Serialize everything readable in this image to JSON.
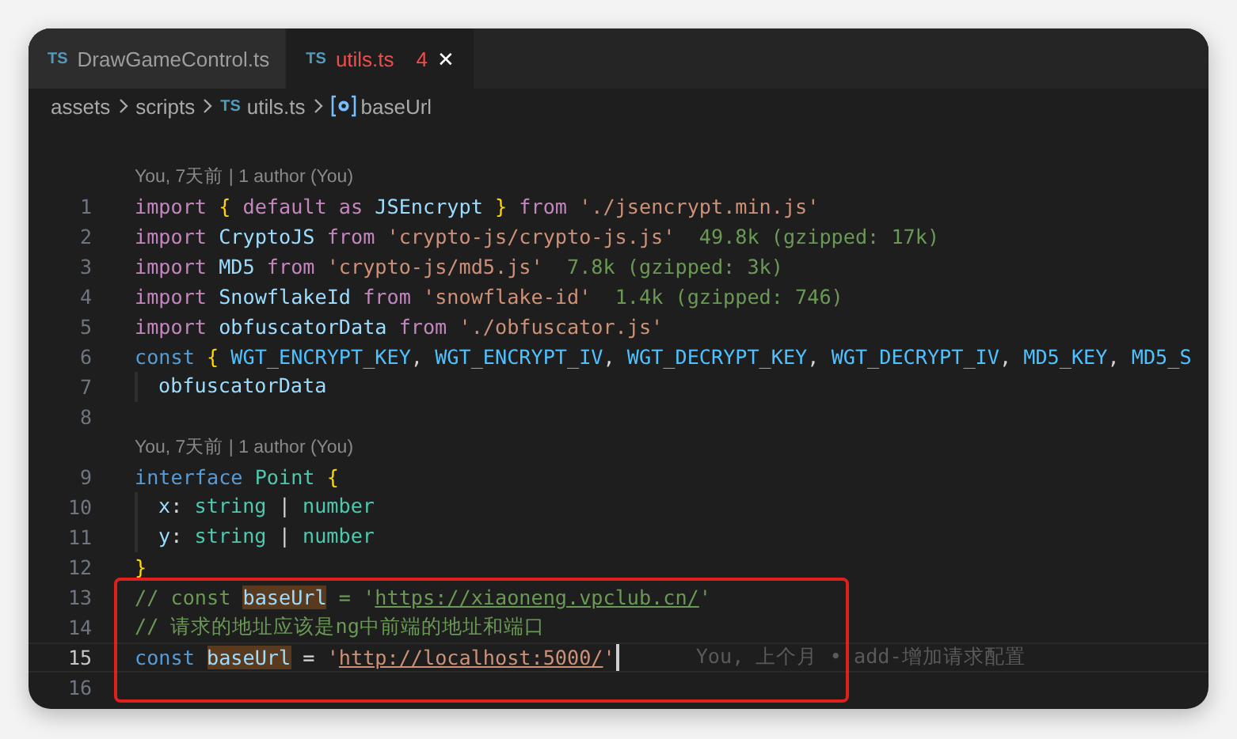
{
  "tabs": [
    {
      "icon_text": "TS",
      "label": "DrawGameControl.ts",
      "selected": false,
      "error": false
    },
    {
      "icon_text": "TS",
      "label": "utils.ts",
      "selected": true,
      "error": true,
      "problems": "4",
      "close": "✕"
    }
  ],
  "breadcrumb": [
    {
      "kind": "folder",
      "text": "assets"
    },
    {
      "kind": "folder",
      "text": "scripts"
    },
    {
      "kind": "file",
      "icon_text": "TS",
      "text": "utils.ts"
    },
    {
      "kind": "symbol",
      "text": "baseUrl"
    }
  ],
  "editor": {
    "lines": [
      {
        "number": "1",
        "codelens": "You, 7天前 | 1 author (You)",
        "current": false,
        "boxed": false,
        "tokens": [
          {
            "kind": "keyword",
            "text": "import "
          },
          {
            "kind": "brace",
            "text": "{ "
          },
          {
            "kind": "keyword",
            "text": "default as "
          },
          {
            "kind": "variable",
            "text": "JSEncrypt "
          },
          {
            "kind": "brace",
            "text": "}"
          },
          {
            "kind": "keyword",
            "text": " from "
          },
          {
            "kind": "string",
            "text": "'./jsencrypt.min.js'"
          }
        ]
      },
      {
        "number": "2",
        "current": false,
        "boxed": false,
        "tokens": [
          {
            "kind": "keyword",
            "text": "import "
          },
          {
            "kind": "variable",
            "text": "CryptoJS "
          },
          {
            "kind": "keyword",
            "text": "from "
          },
          {
            "kind": "string",
            "text": "'crypto-js/crypto-js.js'"
          },
          {
            "kind": "size",
            "text": "  49.8k (gzipped: 17k)"
          }
        ]
      },
      {
        "number": "3",
        "current": false,
        "boxed": false,
        "tokens": [
          {
            "kind": "keyword",
            "text": "import "
          },
          {
            "kind": "variable",
            "text": "MD5 "
          },
          {
            "kind": "keyword",
            "text": "from "
          },
          {
            "kind": "string",
            "text": "'crypto-js/md5.js'"
          },
          {
            "kind": "size",
            "text": "  7.8k (gzipped: 3k)"
          }
        ]
      },
      {
        "number": "4",
        "current": false,
        "boxed": false,
        "tokens": [
          {
            "kind": "keyword",
            "text": "import "
          },
          {
            "kind": "variable",
            "text": "SnowflakeId "
          },
          {
            "kind": "keyword",
            "text": "from "
          },
          {
            "kind": "string",
            "text": "'snowflake-id'"
          },
          {
            "kind": "size",
            "text": "  1.4k (gzipped: 746)"
          }
        ]
      },
      {
        "number": "5",
        "current": false,
        "boxed": false,
        "tokens": [
          {
            "kind": "keyword",
            "text": "import "
          },
          {
            "kind": "variable",
            "text": "obfuscatorData "
          },
          {
            "kind": "keyword",
            "text": "from "
          },
          {
            "kind": "string",
            "text": "'./obfuscator.js'"
          }
        ]
      },
      {
        "number": "6",
        "current": false,
        "boxed": false,
        "tokens": [
          {
            "kind": "storage",
            "text": "const "
          },
          {
            "kind": "brace",
            "text": "{ "
          },
          {
            "kind": "constant",
            "text": "WGT_ENCRYPT_KEY"
          },
          {
            "kind": "plain",
            "text": ", "
          },
          {
            "kind": "constant",
            "text": "WGT_ENCRYPT_IV"
          },
          {
            "kind": "plain",
            "text": ", "
          },
          {
            "kind": "constant",
            "text": "WGT_DECRYPT_KEY"
          },
          {
            "kind": "plain",
            "text": ", "
          },
          {
            "kind": "constant",
            "text": "WGT_DECRYPT_IV"
          },
          {
            "kind": "plain",
            "text": ", "
          },
          {
            "kind": "constant",
            "text": "MD5_KEY"
          },
          {
            "kind": "plain",
            "text": ", "
          },
          {
            "kind": "constant",
            "text": "MD5_S"
          }
        ]
      },
      {
        "number": "7",
        "current": false,
        "boxed": false,
        "indent": true,
        "tokens": [
          {
            "kind": "variable",
            "text": "obfuscatorData"
          }
        ]
      },
      {
        "number": "8",
        "current": false,
        "boxed": false
      },
      {
        "number": "9",
        "codelens": "You, 7天前 | 1 author (You)",
        "current": false,
        "boxed": false,
        "tokens": [
          {
            "kind": "storage",
            "text": "interface "
          },
          {
            "kind": "type",
            "text": "Point "
          },
          {
            "kind": "brace",
            "text": "{"
          }
        ]
      },
      {
        "number": "10",
        "current": false,
        "boxed": false,
        "indent": true,
        "tokens": [
          {
            "kind": "variable",
            "text": "x"
          },
          {
            "kind": "plain",
            "text": ": "
          },
          {
            "kind": "type",
            "text": "string "
          },
          {
            "kind": "plain",
            "text": "| "
          },
          {
            "kind": "type",
            "text": "number"
          }
        ]
      },
      {
        "number": "11",
        "current": false,
        "boxed": false,
        "indent": true,
        "tokens": [
          {
            "kind": "variable",
            "text": "y"
          },
          {
            "kind": "plain",
            "text": ": "
          },
          {
            "kind": "type",
            "text": "string "
          },
          {
            "kind": "plain",
            "text": "| "
          },
          {
            "kind": "type",
            "text": "number"
          }
        ]
      },
      {
        "number": "12",
        "current": false,
        "boxed": false,
        "tokens": [
          {
            "kind": "brace",
            "text": "}"
          }
        ]
      },
      {
        "number": "13",
        "current": false,
        "boxed": true,
        "tokens": [
          {
            "kind": "comment",
            "text": "// const "
          },
          {
            "kind": "match",
            "text": "baseUrl"
          },
          {
            "kind": "comment",
            "text": " = '"
          },
          {
            "kind": "comment-link",
            "text": "https://xiaoneng.vpclub.cn/"
          },
          {
            "kind": "comment",
            "text": "'"
          }
        ]
      },
      {
        "number": "14",
        "current": false,
        "boxed": true,
        "tokens": [
          {
            "kind": "comment",
            "text": "// 请求的地址应该是ng中前端的地址和端口"
          }
        ]
      },
      {
        "number": "15",
        "current": true,
        "boxed": true,
        "blame": "You, 上个月 • add-增加请求配置",
        "tokens": [
          {
            "kind": "storage",
            "text": "const "
          },
          {
            "kind": "match",
            "text": "baseUrl"
          },
          {
            "kind": "plain",
            "text": " = "
          },
          {
            "kind": "string",
            "text": "'"
          },
          {
            "kind": "link",
            "text": "http://localhost:5000/"
          },
          {
            "kind": "string",
            "text": "'"
          }
        ]
      },
      {
        "number": "16",
        "current": false,
        "boxed": true
      }
    ]
  }
}
